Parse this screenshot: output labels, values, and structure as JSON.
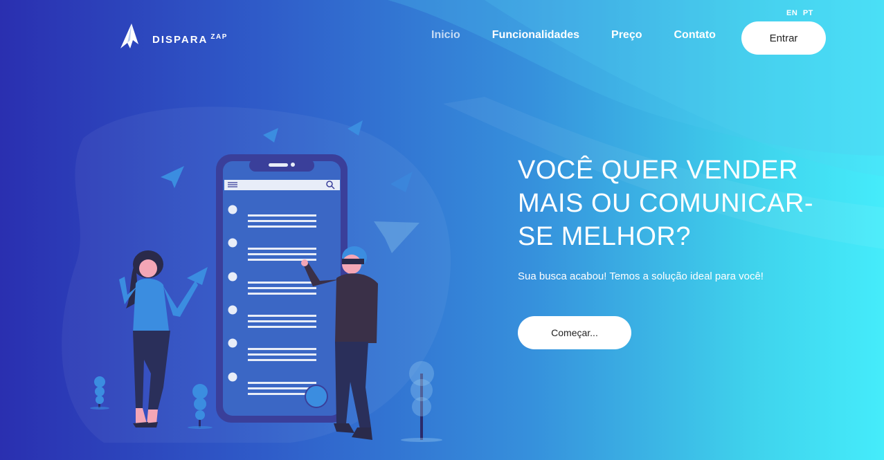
{
  "lang": {
    "en": "EN",
    "pt": "PT"
  },
  "logo": {
    "name": "DISPARA",
    "suffix": "ZAP",
    "icon": "paper-plane-logo-icon"
  },
  "nav": {
    "items": [
      {
        "label": "Inicio",
        "active": true
      },
      {
        "label": "Funcionalidades",
        "active": false
      },
      {
        "label": "Preço",
        "active": false
      },
      {
        "label": "Contato",
        "active": false
      }
    ],
    "login_label": "Entrar"
  },
  "hero": {
    "title": "VOCÊ QUER VENDER MAIS OU COMUNICAR-SE MELHOR?",
    "subtitle": "Sua busca acabou! Temos a solução ideal para você!",
    "cta_label": "Começar..."
  },
  "colors": {
    "gradient_start": "#2a2fb0",
    "gradient_end": "#45ecfb",
    "phone": "#3a3f9a",
    "accent": "#3b8de0"
  }
}
